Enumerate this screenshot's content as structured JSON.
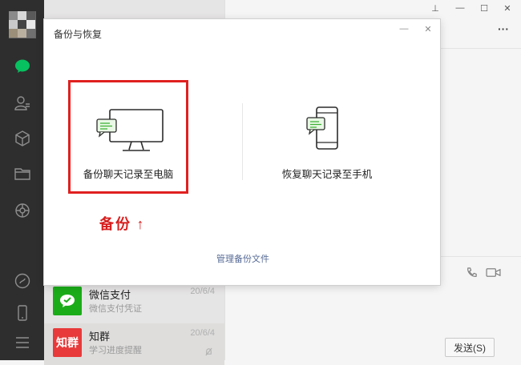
{
  "colors": {
    "sidebar_bg": "#2e2e2e",
    "chat_icon_active": "#07c160",
    "highlight": "#e02020",
    "link": "#576b95"
  },
  "window": {
    "pin_glyph": "⊥",
    "minimize_glyph": "—",
    "maximize_glyph": "☐",
    "close_glyph": "✕",
    "more_glyph": "···"
  },
  "sidebar": {
    "icons": [
      "chat-icon",
      "contacts-icon",
      "favorites-cube-icon",
      "folder-icon",
      "moments-icon",
      "mini-program-icon",
      "phone-icon",
      "menu-icon"
    ]
  },
  "chat_list": {
    "items": [
      {
        "name": "微信支付",
        "time": "20/6/4",
        "preview": "微信支付凭证",
        "avatar_color": "#1aad19"
      },
      {
        "name": "知群",
        "time": "20/6/4",
        "preview": "学习进度提醒",
        "avatar_color": "#e83a3a",
        "avatar_text": "知群"
      }
    ]
  },
  "dialog": {
    "title": "备份与恢复",
    "minimize_glyph": "—",
    "close_glyph": "✕",
    "backup_option": "备份聊天记录至电脑",
    "restore_option": "恢复聊天记录至手机",
    "manage_link": "管理备份文件"
  },
  "annotation": {
    "text": "备份 ↑"
  },
  "chat_window": {
    "send_label": "发送(S)"
  }
}
